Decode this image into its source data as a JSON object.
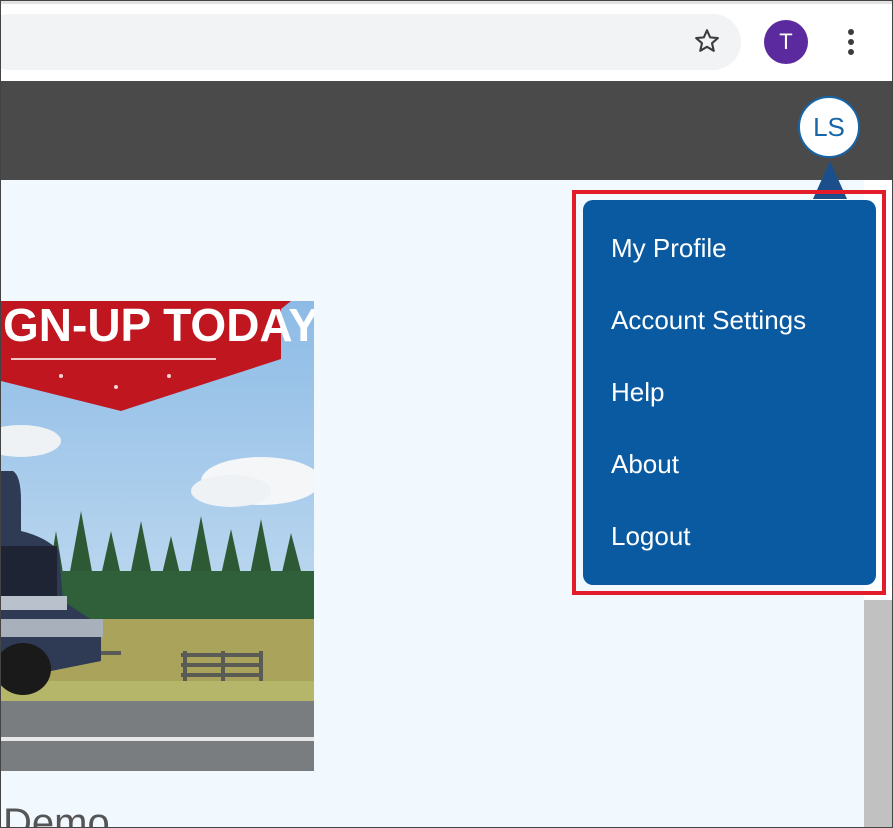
{
  "browser": {
    "profile_initial": "T",
    "icons": {
      "bookmark": "star-icon",
      "menu": "kebab-menu-icon"
    }
  },
  "header": {
    "avatar_initials": "LS"
  },
  "user_menu": {
    "items": [
      {
        "label": "My Profile"
      },
      {
        "label": "Account Settings"
      },
      {
        "label": "Help"
      },
      {
        "label": "About"
      },
      {
        "label": "Logout"
      }
    ]
  },
  "promo": {
    "banner_text": "GN-UP TODAY"
  },
  "page": {
    "partial_heading": "Demo"
  },
  "colors": {
    "header_bar": "#4a4a4a",
    "menu_bg": "#0a5aa2",
    "highlight": "#e21c2b",
    "content_bg": "#f1f8fe",
    "banner_red": "#c0161f"
  }
}
